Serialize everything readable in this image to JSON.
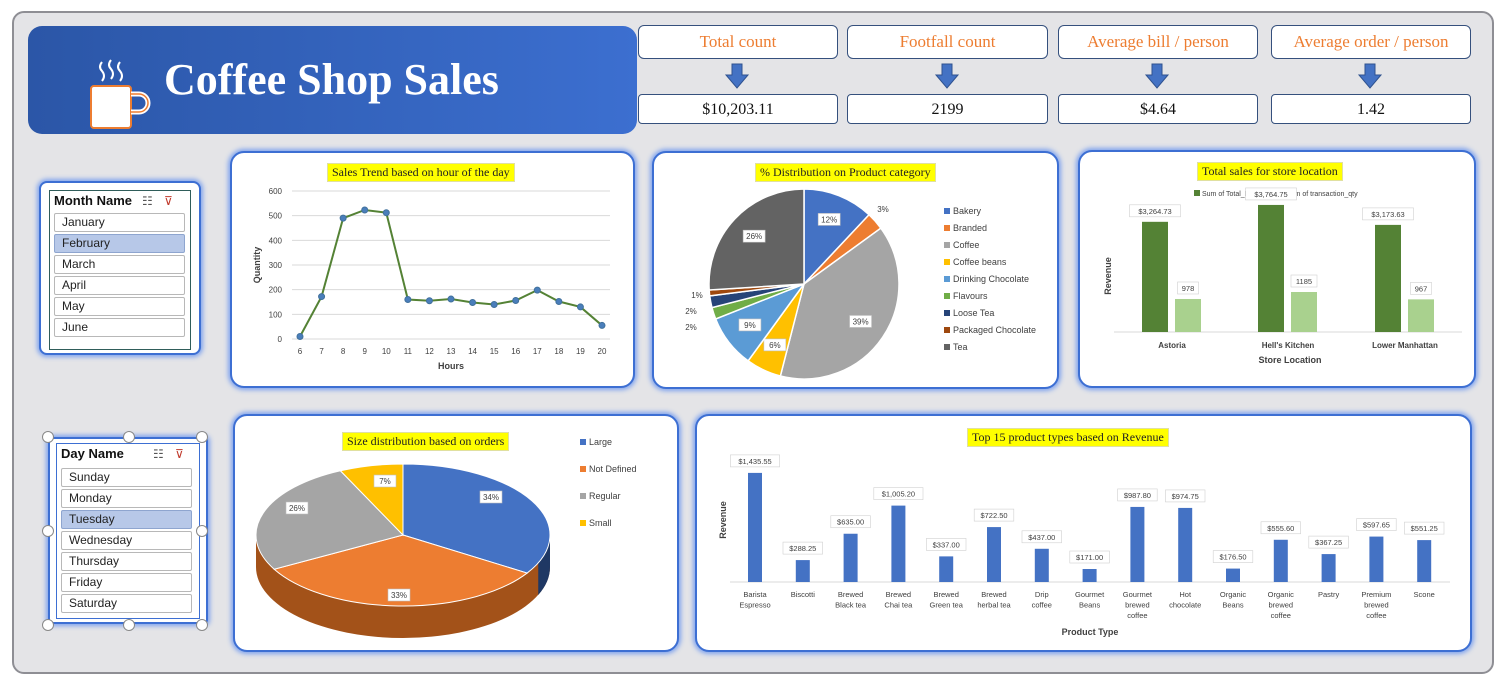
{
  "header": {
    "title": "Coffee Shop Sales",
    "icon": "coffee-cup-icon"
  },
  "kpis": [
    {
      "label": "Total count",
      "value": "$10,203.11"
    },
    {
      "label": "Footfall count",
      "value": "2199"
    },
    {
      "label": "Average bill / person",
      "value": "$4.64"
    },
    {
      "label": "Average order / person",
      "value": "1.42"
    }
  ],
  "month_slicer": {
    "title": "Month Name",
    "items": [
      "January",
      "February",
      "March",
      "April",
      "May",
      "June"
    ],
    "selected": "February"
  },
  "day_slicer": {
    "title": "Day Name",
    "items": [
      "Sunday",
      "Monday",
      "Tuesday",
      "Wednesday",
      "Thursday",
      "Friday",
      "Saturday"
    ],
    "selected": "Tuesday"
  },
  "colors": {
    "accent": "#3d6fd3",
    "header": "#2b56a7",
    "kpi_text": "#ed7d31",
    "title_bg": "#ffff00"
  },
  "chart_data": [
    {
      "id": "hourly",
      "type": "line",
      "title": "Sales Trend based on hour of the day",
      "xlabel": "Hours",
      "ylabel": "Quantity",
      "x": [
        6,
        7,
        8,
        9,
        10,
        11,
        12,
        13,
        14,
        15,
        16,
        17,
        18,
        19,
        20
      ],
      "values": [
        10,
        172,
        490,
        523,
        512,
        160,
        155,
        162,
        148,
        140,
        156,
        198,
        152,
        130,
        55
      ],
      "ylim": [
        0,
        600
      ],
      "yticks": [
        0,
        100,
        200,
        300,
        400,
        500,
        600
      ],
      "grid": true,
      "color": "#548235"
    },
    {
      "id": "category",
      "type": "pie",
      "title": "% Distribution on Product category",
      "categories": [
        "Bakery",
        "Branded",
        "Coffee",
        "Coffee beans",
        "Drinking Chocolate",
        "Flavours",
        "Loose Tea",
        "Packaged Chocolate",
        "Tea"
      ],
      "values": [
        12,
        3,
        39,
        6,
        9,
        2,
        2,
        1,
        26
      ],
      "labels": [
        "12%",
        "3%",
        "39%",
        "6%",
        "9%",
        "2%",
        "2%",
        "1%",
        "26%"
      ],
      "colors": [
        "#4472c4",
        "#ed7d31",
        "#a5a5a5",
        "#ffc000",
        "#5b9bd5",
        "#70ad47",
        "#264478",
        "#9e480e",
        "#636363"
      ],
      "legend": "right"
    },
    {
      "id": "store",
      "type": "bar",
      "title": "Total sales for store location",
      "xlabel": "Store Location",
      "ylabel": "Revenue",
      "categories": [
        "Astoria",
        "Hell's Kitchen",
        "Lower Manhattan"
      ],
      "series": [
        {
          "name": "Sum of Total_Bill",
          "values": [
            3264.73,
            3764.75,
            3173.63
          ],
          "labels": [
            "$3,264.73",
            "$3,764.75",
            "$3,173.63"
          ],
          "color": "#548235"
        },
        {
          "name": "Sum of transaction_qty",
          "values": [
            978,
            1185,
            967
          ],
          "labels": [
            "978",
            "1185",
            "967"
          ],
          "color": "#a9d18e"
        }
      ],
      "ylim": [
        0,
        4000
      ],
      "legend": "top"
    },
    {
      "id": "size",
      "type": "pie",
      "title": "Size distribution based on orders",
      "categories": [
        "Large",
        "Not Defined",
        "Regular",
        "Small"
      ],
      "values": [
        34,
        33,
        26,
        7
      ],
      "labels": [
        "34%",
        "33%",
        "26%",
        "7%"
      ],
      "colors": [
        "#4472c4",
        "#ed7d31",
        "#a5a5a5",
        "#ffc000"
      ],
      "legend": "right"
    },
    {
      "id": "products",
      "type": "bar",
      "title": "Top 15 product types based on Revenue",
      "xlabel": "Product Type",
      "ylabel": "Revenue",
      "categories": [
        "Barista Espresso",
        "Biscotti",
        "Brewed Black tea",
        "Brewed Chai tea",
        "Brewed Green tea",
        "Brewed herbal tea",
        "Drip coffee",
        "Gourmet Beans",
        "Gourmet brewed coffee",
        "Hot chocolate",
        "Organic Beans",
        "Organic brewed coffee",
        "Pastry",
        "Premium brewed coffee",
        "Scone"
      ],
      "values": [
        1435.55,
        288.25,
        635.0,
        1005.2,
        337.0,
        722.5,
        437.0,
        171.0,
        987.8,
        974.75,
        176.5,
        555.6,
        367.25,
        597.65,
        551.25
      ],
      "labels": [
        "$1,435.55",
        "$288.25",
        "$635.00",
        "$1,005.20",
        "$337.00",
        "$722.50",
        "$437.00",
        "$171.00",
        "$987.80",
        "$974.75",
        "$176.50",
        "$555.60",
        "$367.25",
        "$597.65",
        "$551.25"
      ],
      "ylim": [
        0,
        1500
      ],
      "color": "#4472c4"
    }
  ]
}
